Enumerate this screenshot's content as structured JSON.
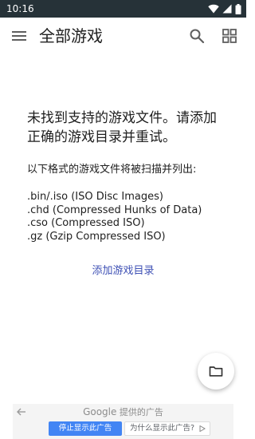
{
  "status_bar": {
    "time": "10:16",
    "icons": [
      "wifi-icon",
      "cellular-signal-icon",
      "battery-icon"
    ],
    "background": "#263238"
  },
  "app_bar": {
    "title": "全部游戏",
    "icons": [
      "menu-icon",
      "search-icon",
      "grid-view-icon"
    ]
  },
  "empty_state": {
    "message": "未找到支持的游戏文件。请添加正确的游戏目录并重试。",
    "formats_intro": "以下格式的游戏文件将被扫描并列出:",
    "formats": [
      ".bin/.iso (ISO Disc Images)",
      ".chd (Compressed Hunks of Data)",
      ".cso (Compressed ISO)",
      ".gz (Gzip Compressed ISO)"
    ],
    "add_directory_label": "添加游戏目录",
    "accent_color": "#3f51b5"
  },
  "fab": {
    "icon": "folder-icon"
  },
  "ad": {
    "brand": "Google",
    "header": "提供的广告",
    "stop_label": "停止显示此广告",
    "why_label": "为什么显示此广告?",
    "stop_color": "#4285f4"
  }
}
